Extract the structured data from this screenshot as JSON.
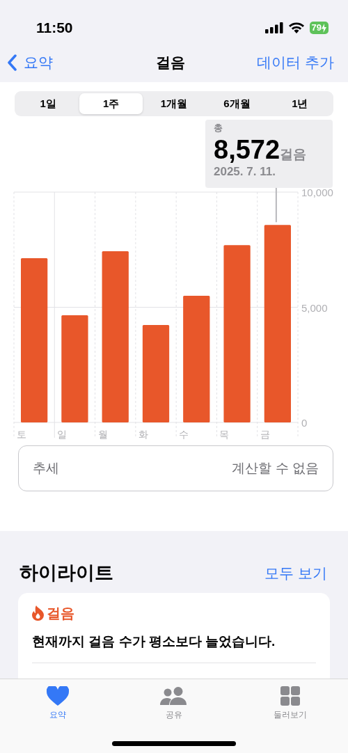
{
  "status_bar": {
    "time": "11:50",
    "battery": "79"
  },
  "nav": {
    "back": "요약",
    "title": "걸음",
    "action": "데이터 추가"
  },
  "segments": [
    {
      "label": "1일",
      "selected": false
    },
    {
      "label": "1주",
      "selected": true
    },
    {
      "label": "1개월",
      "selected": false
    },
    {
      "label": "6개월",
      "selected": false
    },
    {
      "label": "1년",
      "selected": false
    }
  ],
  "tooltip": {
    "label": "총",
    "value": "8,572",
    "unit": "걸음",
    "date": "2025. 7. 11."
  },
  "chart": {
    "chart_data": {
      "type": "bar",
      "categories": [
        "토",
        "일",
        "월",
        "화",
        "수",
        "목",
        "금"
      ],
      "series": [
        {
          "color": "#e8572a",
          "values": [
            7130,
            4650,
            7430,
            4230,
            5500,
            7700,
            8572
          ]
        }
      ],
      "ylim": [
        0,
        10000
      ],
      "yticks": [
        {
          "value": 0,
          "label": "0"
        },
        {
          "value": 5000,
          "label": "5,000"
        },
        {
          "value": 10000,
          "label": "10,000"
        }
      ]
    }
  },
  "trend": {
    "label": "추세",
    "value": "계산할 수 없음"
  },
  "highlights": {
    "title": "하이라이트",
    "see_all": "모두 보기",
    "card": {
      "category": "걸음",
      "text": "현재까지 걸음 수가 평소보다 늘었습니다."
    }
  },
  "tab_bar": [
    {
      "label": "요약",
      "kind": "heart",
      "selected": true
    },
    {
      "label": "공유",
      "kind": "people",
      "selected": false
    },
    {
      "label": "둘러보기",
      "kind": "grid",
      "selected": false
    }
  ]
}
